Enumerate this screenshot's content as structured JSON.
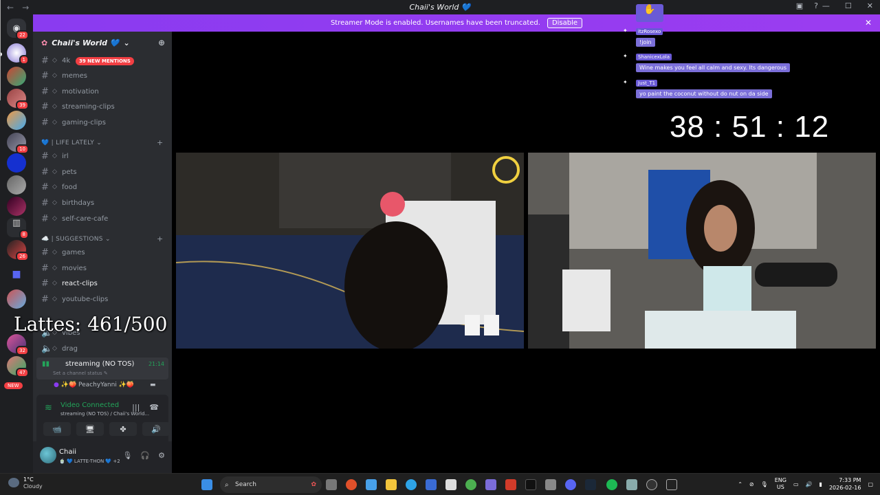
{
  "window": {
    "title": "Chaii's World 💙",
    "back": "←",
    "forward": "→",
    "minimize": "—",
    "maximize": "☐",
    "close": "✕"
  },
  "banner": {
    "text": "Streamer Mode is enabled. Usernames have been truncated.",
    "disable_label": "Disable",
    "close": "✕"
  },
  "server": {
    "name": "Chaii's World 💙",
    "chevron": "⌄",
    "mentions_badge": "39 NEW MENTIONS"
  },
  "rail_badges": [
    "22",
    "1",
    "39",
    "10",
    "8",
    "26",
    "32",
    "47",
    "NEW"
  ],
  "channels_top": [
    {
      "name": "4k"
    },
    {
      "name": "memes"
    },
    {
      "name": "motivation"
    },
    {
      "name": "streaming-clips"
    },
    {
      "name": "gaming-clips"
    }
  ],
  "category_life": "💙 | LIFE LATELY ⌄",
  "channels_life": [
    {
      "name": "irl"
    },
    {
      "name": "pets"
    },
    {
      "name": "food"
    },
    {
      "name": "birthdays"
    },
    {
      "name": "self-care-cafe"
    }
  ],
  "category_suggestions": "☁️ | SUGGESTIONS ⌄",
  "channels_suggestions": [
    {
      "name": "games"
    },
    {
      "name": "movies"
    },
    {
      "name": "react-clips"
    },
    {
      "name": "youtube-clips"
    }
  ],
  "voice_channels": [
    {
      "name": "vibes"
    },
    {
      "name": "drag"
    }
  ],
  "overlay_text": "Lattes: 461/500",
  "streaming": {
    "name": "streaming (NO TOS)",
    "time": "21:14",
    "status": "Set a channel status ✎",
    "member": "✨🍑 PeachyYanni ✨🍑"
  },
  "voice": {
    "connected": "Video Connected",
    "subtext": "streaming (NO TOS) / Chaii's World...",
    "buttons": [
      "📹",
      "🖥",
      "✤",
      "🔊"
    ]
  },
  "user": {
    "name": "Chaii",
    "status": "🍵 💙 LATTE-THON 💙 +2"
  },
  "chat": [
    {
      "user": "itzRosexo",
      "message": "!join"
    },
    {
      "user": "ShanicexLola",
      "message": "Wine makes you feel all calm and sexy. Its dangerous"
    },
    {
      "user": "Just_T1",
      "message": "yo paint the coconut without do nut on da side"
    }
  ],
  "timer": "38 : 51 : 12",
  "taskbar": {
    "temp": "1°C",
    "weather": "Cloudy",
    "search": "Search",
    "lang1": "ENG",
    "lang2": "US",
    "time": "7:33 PM",
    "date": "2026-02-16"
  },
  "colors": {
    "banner": "#8a3bf0",
    "accent_green": "#23a55a",
    "badge_red": "#f23f43",
    "sidebar": "#2b2d31",
    "rail": "#1e1f22"
  }
}
